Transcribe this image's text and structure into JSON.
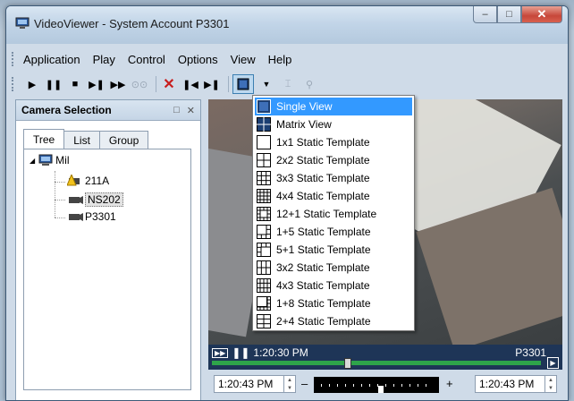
{
  "window": {
    "title": "VideoViewer - System Account P3301",
    "minimize": "–",
    "maximize": "□",
    "close": "✕"
  },
  "menubar": {
    "items": [
      "Application",
      "Play",
      "Control",
      "Options",
      "View",
      "Help"
    ]
  },
  "camera_panel": {
    "title": "Camera Selection",
    "tabs": [
      "Tree",
      "List",
      "Group"
    ],
    "tree": {
      "root": "Mil",
      "children": [
        "211A",
        "NS202",
        "P3301"
      ]
    }
  },
  "video": {
    "time": "1:20:30 PM",
    "camera": "P3301",
    "progress": 0.41
  },
  "bottom": {
    "start_time": "1:20:43 PM",
    "end_time": "1:20:43 PM",
    "minus": "–",
    "plus": "+"
  },
  "layout_menu": {
    "items": [
      "Single View",
      "Matrix View",
      "1x1 Static Template",
      "2x2 Static Template",
      "3x3 Static Template",
      "4x4 Static Template",
      "12+1 Static Template",
      "1+5 Static Template",
      "5+1 Static Template",
      "3x2 Static Template",
      "4x3 Static Template",
      "1+8 Static Template",
      "2+4 Static Template"
    ],
    "highlighted": "Single View"
  }
}
